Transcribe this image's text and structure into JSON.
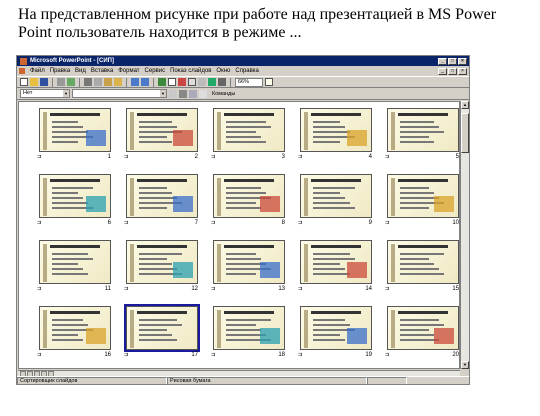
{
  "question": "На представленном рисунке при работе над презентацией в MS Power Point пользователь находится в режиме ...",
  "window": {
    "title": "Microsoft PowerPoint - [СИП]",
    "menu": [
      "Файл",
      "Правка",
      "Вид",
      "Вставка",
      "Формат",
      "Сервис",
      "Показ слайдов",
      "Окно",
      "Справка"
    ],
    "zoom": "66%",
    "font_box": "Нет",
    "commands_label": "Команды"
  },
  "slides": [
    {
      "num": "1"
    },
    {
      "num": "2"
    },
    {
      "num": "3"
    },
    {
      "num": "4"
    },
    {
      "num": "5"
    },
    {
      "num": "6"
    },
    {
      "num": "7"
    },
    {
      "num": "8"
    },
    {
      "num": "9"
    },
    {
      "num": "10"
    },
    {
      "num": "11"
    },
    {
      "num": "12"
    },
    {
      "num": "13"
    },
    {
      "num": "14"
    },
    {
      "num": "15"
    },
    {
      "num": "16"
    },
    {
      "num": "17"
    },
    {
      "num": "18"
    },
    {
      "num": "19"
    },
    {
      "num": "20"
    }
  ],
  "selected_slide": 17,
  "statusbar": {
    "view": "Сортировщик слайдов",
    "design": "Рисовая бумага"
  },
  "colors": {
    "titlebar": "#0a246a",
    "selection": "#1a1a9e",
    "slide_bg": "#fdfbe6"
  }
}
